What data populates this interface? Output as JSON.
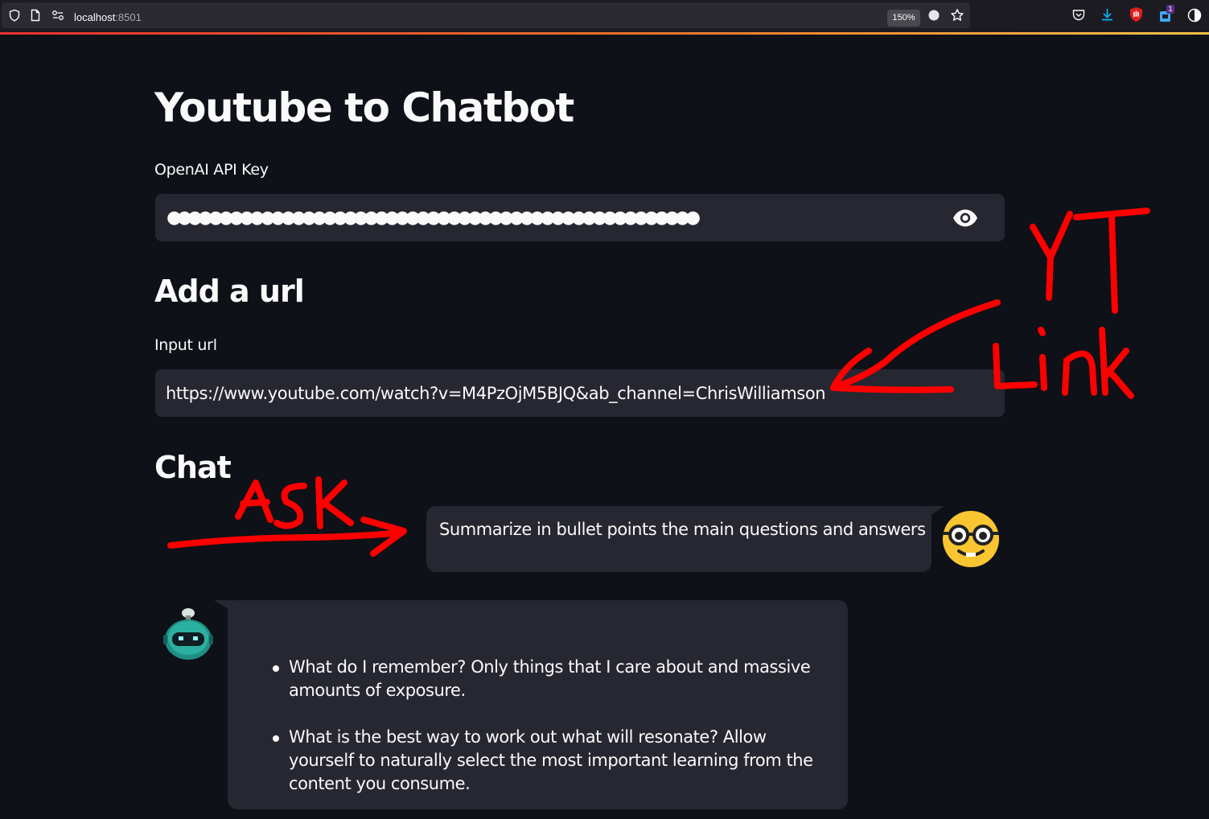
{
  "browser": {
    "url_host": "localhost",
    "url_port": ":8501",
    "zoom": "150%",
    "extension_badge": "1",
    "accent_colors": [
      "#e8312f",
      "#f0762a",
      "#f2c14a"
    ]
  },
  "app": {
    "title": "Youtube to Chatbot",
    "api_key": {
      "label": "OpenAI API Key",
      "masked_value": "●●●●●●●●●●●●●●●●●●●●●●●●●●●●●●●●●●●●●●●●●●●●●●●●●●●",
      "visibility_icon": "eye-icon"
    },
    "url_section": {
      "heading": "Add a url",
      "label": "Input url",
      "value": "https://www.youtube.com/watch?v=M4PzOjM5BJQ&ab_channel=ChrisWilliamson"
    },
    "chat": {
      "heading": "Chat",
      "user_message": "Summarize in bullet points the main questions and answers",
      "user_avatar": "nerd-face-emoji",
      "bot_avatar": "robot-icon",
      "bot_bullets": [
        "What do I remember? Only things that I care about and massive amounts of exposure.",
        "What is the best way to work out what will resonate? Allow yourself to naturally select the most important learning from the content you consume."
      ]
    }
  },
  "annotations": {
    "color": "#ff0000"
  },
  "colors": {
    "background": "#0e1117",
    "input_bg": "#262730",
    "text": "#fafafa"
  }
}
